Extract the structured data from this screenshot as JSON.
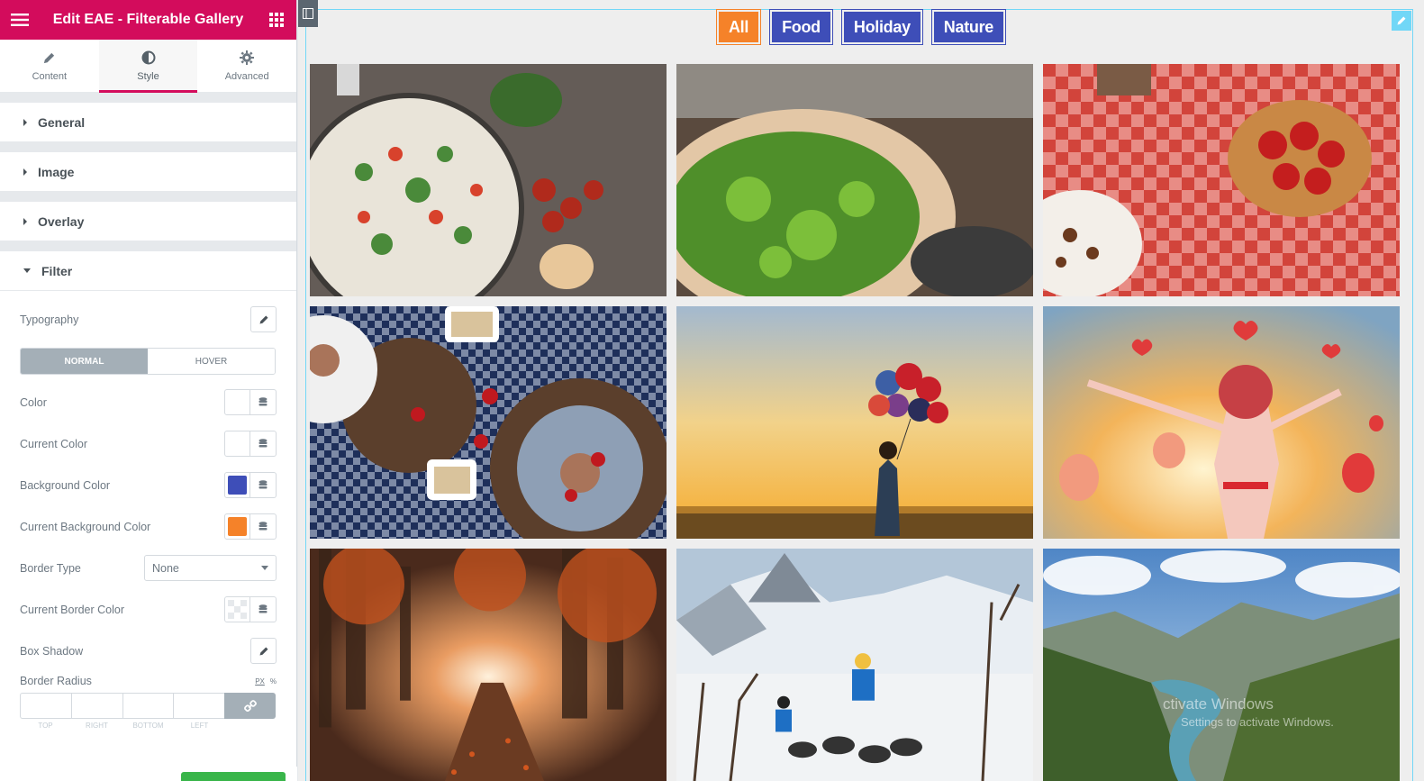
{
  "panel": {
    "title": "Edit EAE - Filterable Gallery",
    "tabs": [
      {
        "label": "Content",
        "icon": "pencil-icon"
      },
      {
        "label": "Style",
        "icon": "contrast-icon"
      },
      {
        "label": "Advanced",
        "icon": "gear-icon"
      }
    ],
    "active_tab": "Style",
    "sections": [
      {
        "label": "General",
        "open": false
      },
      {
        "label": "Image",
        "open": false
      },
      {
        "label": "Overlay",
        "open": false
      },
      {
        "label": "Filter",
        "open": true
      }
    ],
    "filter": {
      "typography_label": "Typography",
      "state_tabs": [
        "NORMAL",
        "HOVER"
      ],
      "active_state": "NORMAL",
      "color_label": "Color",
      "current_color_label": "Current Color",
      "background_color_label": "Background Color",
      "background_color": "#3e4eb8",
      "current_background_color_label": "Current Background Color",
      "current_background_color": "#f58229",
      "border_type_label": "Border Type",
      "border_type_value": "None",
      "current_border_color_label": "Current Border Color",
      "box_shadow_label": "Box Shadow",
      "border_radius_label": "Border Radius",
      "units": [
        "PX",
        "%"
      ],
      "dimension_labels": [
        "TOP",
        "RIGHT",
        "BOTTOM",
        "LEFT"
      ]
    }
  },
  "gallery": {
    "filters": [
      {
        "label": "All",
        "active": true
      },
      {
        "label": "Food",
        "active": false
      },
      {
        "label": "Holiday",
        "active": false
      },
      {
        "label": "Nature",
        "active": false
      }
    ],
    "images": [
      {
        "subject": "pizza-with-vegetables",
        "category": "Food"
      },
      {
        "subject": "salad-bowl",
        "category": "Food"
      },
      {
        "subject": "strawberries-on-picnic-cloth",
        "category": "Food"
      },
      {
        "subject": "picnic-table-snacks",
        "category": "Food"
      },
      {
        "subject": "girl-with-balloons-at-sunset",
        "category": "Holiday"
      },
      {
        "subject": "girl-with-heart-balloons",
        "category": "Holiday"
      },
      {
        "subject": "autumn-forest-path",
        "category": "Nature"
      },
      {
        "subject": "dog-sledding-mountains",
        "category": "Holiday"
      },
      {
        "subject": "mountain-valley-river",
        "category": "Nature"
      }
    ]
  },
  "watermark": {
    "line1": "ctivate Windows",
    "line2": "Settings to activate Windows."
  },
  "colors": {
    "brand": "#d30c5c",
    "filter_bg": "#3e4eb8",
    "filter_active_bg": "#f58229",
    "selection_outline": "#71d7f7"
  }
}
